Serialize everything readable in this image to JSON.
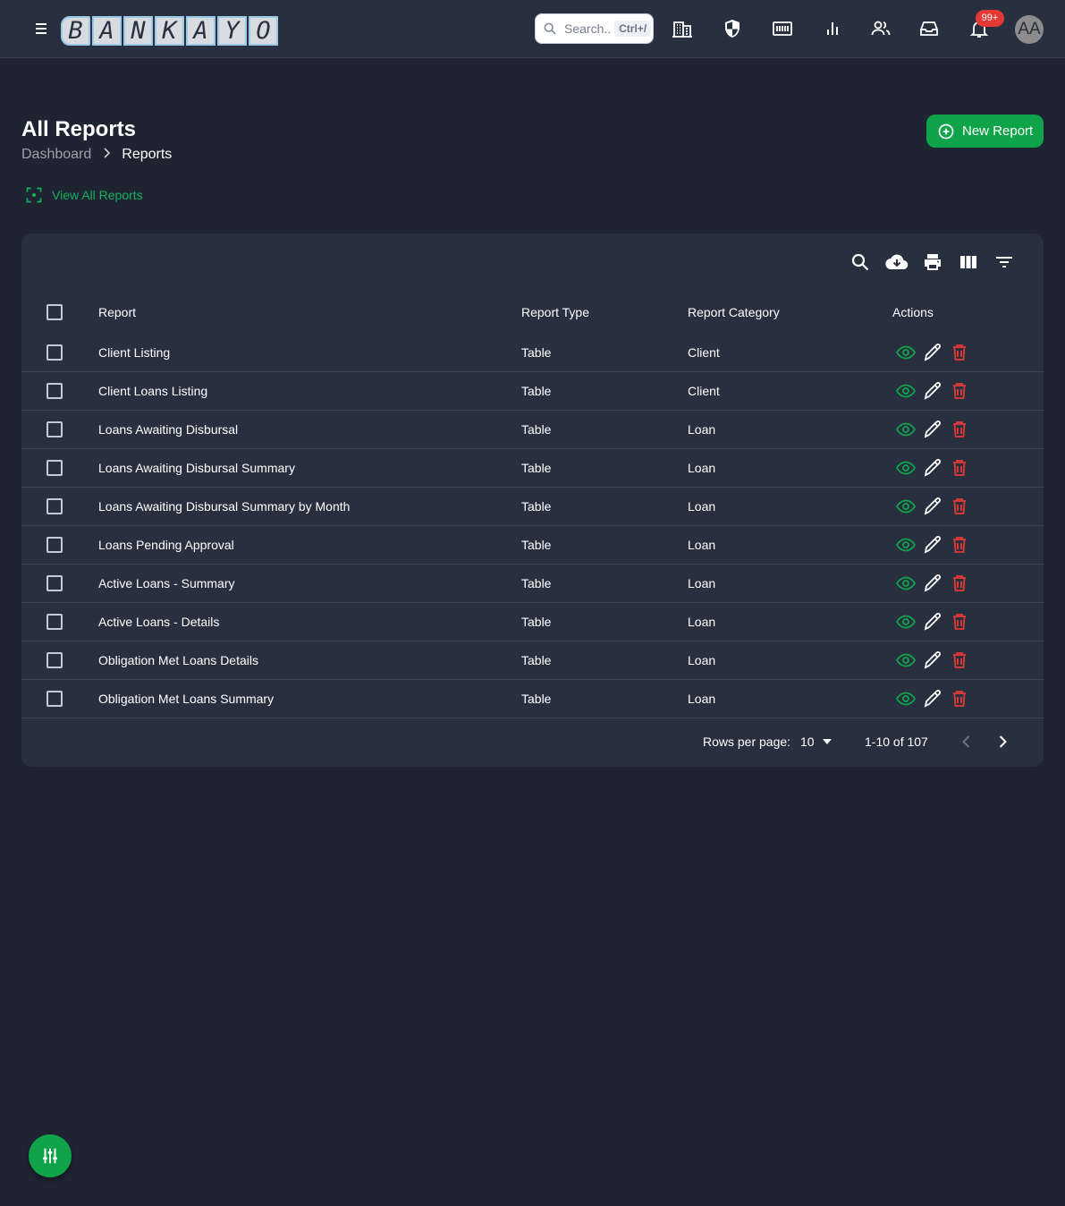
{
  "app": {
    "logo_letters": [
      "B",
      "A",
      "N",
      "K",
      "A",
      "Y",
      "O"
    ],
    "search_placeholder": "Search..",
    "search_shortcut": "Ctrl+/",
    "notification_count": "99+",
    "avatar_initials": "AA",
    "toolbar_icons": [
      "organization-icon",
      "security-icon",
      "accounting-icon",
      "reports-icon",
      "users-icon",
      "inbox-icon",
      "notifications-icon"
    ]
  },
  "page": {
    "title": "All Reports",
    "breadcrumb": [
      "Dashboard",
      "Reports"
    ],
    "new_button": "New Report",
    "view_all_link": "View All Reports"
  },
  "table": {
    "tools": [
      "search-icon",
      "download-icon",
      "print-icon",
      "columns-icon",
      "filter-icon"
    ],
    "columns": [
      "Report",
      "Report Type",
      "Report Category",
      "Actions"
    ],
    "rows": [
      {
        "report": "Client Listing",
        "type": "Table",
        "category": "Client"
      },
      {
        "report": "Client Loans Listing",
        "type": "Table",
        "category": "Client"
      },
      {
        "report": "Loans Awaiting Disbursal",
        "type": "Table",
        "category": "Loan"
      },
      {
        "report": "Loans Awaiting Disbursal Summary",
        "type": "Table",
        "category": "Loan"
      },
      {
        "report": "Loans Awaiting Disbursal Summary by Month",
        "type": "Table",
        "category": "Loan"
      },
      {
        "report": "Loans Pending Approval",
        "type": "Table",
        "category": "Loan"
      },
      {
        "report": "Active Loans - Summary",
        "type": "Table",
        "category": "Loan"
      },
      {
        "report": "Active Loans - Details",
        "type": "Table",
        "category": "Loan"
      },
      {
        "report": "Obligation Met Loans Details",
        "type": "Table",
        "category": "Loan"
      },
      {
        "report": "Obligation Met Loans Summary",
        "type": "Table",
        "category": "Loan"
      }
    ],
    "footer": {
      "rows_per_page_label": "Rows per page:",
      "rows_per_page_value": "10",
      "range": "1-10 of 107"
    }
  },
  "colors": {
    "background": "#1f2433",
    "surface": "#283040",
    "accent_green": "#0fa44a",
    "delete_red": "#e53935",
    "badge_red": "#e53935"
  }
}
